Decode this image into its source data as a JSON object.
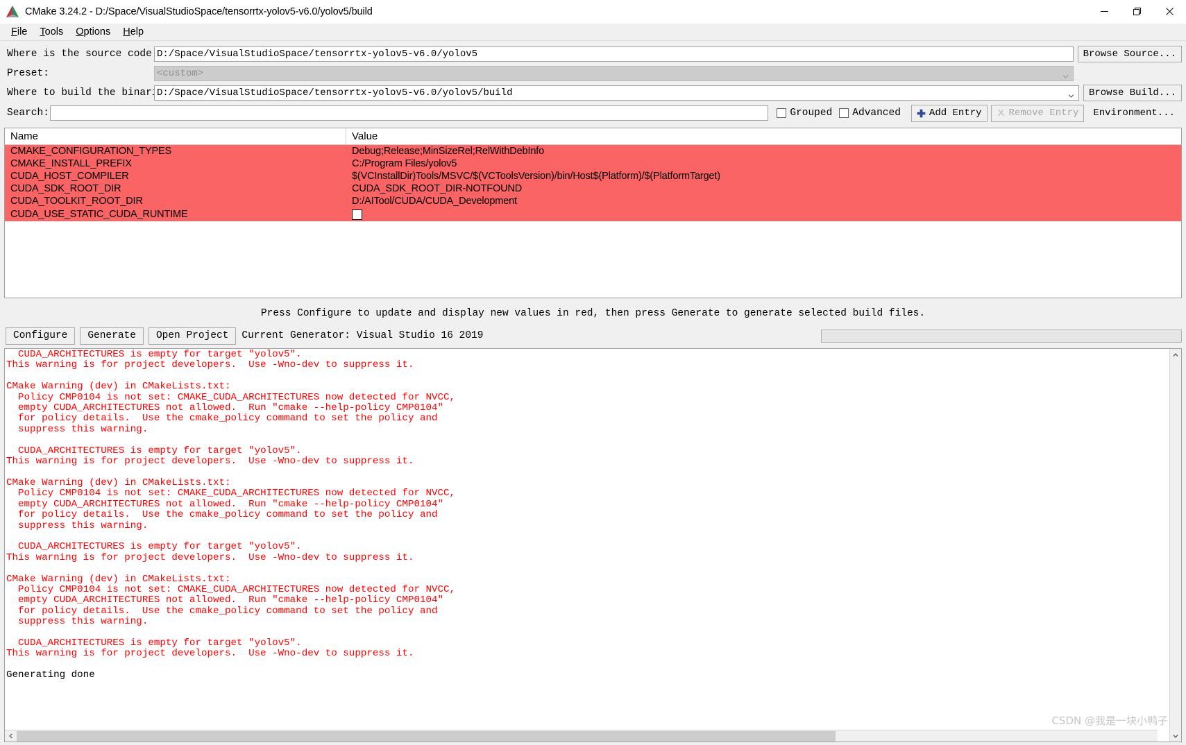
{
  "window": {
    "title": "CMake 3.24.2 - D:/Space/VisualStudioSpace/tensorrtx-yolov5-v6.0/yolov5/build",
    "app_icon": "cmake-logo-icon",
    "minimize_label": "—",
    "maximize_label": "❐",
    "close_label": "✕"
  },
  "menu": {
    "items": [
      {
        "label": "File",
        "mnemonic": "F"
      },
      {
        "label": "Tools",
        "mnemonic": "T"
      },
      {
        "label": "Options",
        "mnemonic": "O"
      },
      {
        "label": "Help",
        "mnemonic": "H"
      }
    ]
  },
  "form": {
    "source_label": "Where is the source code:",
    "source_value": "D:/Space/VisualStudioSpace/tensorrtx-yolov5-v6.0/yolov5",
    "browse_source_label": "Browse Source...",
    "preset_label": "Preset:",
    "preset_value": "<custom>",
    "build_label": "Where to build the binaries:",
    "build_value": "D:/Space/VisualStudioSpace/tensorrtx-yolov5-v6.0/yolov5/build",
    "browse_build_label": "Browse Build..."
  },
  "search": {
    "label": "Search:",
    "value": "",
    "placeholder": "",
    "grouped_label": "Grouped",
    "grouped_checked": false,
    "advanced_label": "Advanced",
    "advanced_checked": false,
    "add_entry_label": "Add Entry",
    "add_entry_icon": "plus-icon",
    "remove_entry_label": "Remove Entry",
    "remove_entry_icon": "remove-x-icon",
    "remove_entry_disabled": true,
    "environment_label": "Environment..."
  },
  "cache_table": {
    "columns": [
      "Name",
      "Value"
    ],
    "row_color": "#fa6464",
    "rows": [
      {
        "name": "CMAKE_CONFIGURATION_TYPES",
        "value": "Debug;Release;MinSizeRel;RelWithDebInfo",
        "type": "text"
      },
      {
        "name": "CMAKE_INSTALL_PREFIX",
        "value": "C:/Program Files/yolov5",
        "type": "text"
      },
      {
        "name": "CUDA_HOST_COMPILER",
        "value": "$(VCInstallDir)Tools/MSVC/$(VCToolsVersion)/bin/Host$(Platform)/$(PlatformTarget)",
        "type": "text"
      },
      {
        "name": "CUDA_SDK_ROOT_DIR",
        "value": "CUDA_SDK_ROOT_DIR-NOTFOUND",
        "type": "text"
      },
      {
        "name": "CUDA_TOOLKIT_ROOT_DIR",
        "value": "D:/AITool/CUDA/CUDA_Development",
        "type": "text"
      },
      {
        "name": "CUDA_USE_STATIC_CUDA_RUNTIME",
        "value": "",
        "type": "checkbox",
        "checked": false
      }
    ]
  },
  "hint": "Press Configure to update and display new values in red, then press Generate to generate selected build files.",
  "actions": {
    "configure_label": "Configure",
    "generate_label": "Generate",
    "open_project_label": "Open Project",
    "current_generator": "Current Generator: Visual Studio 16 2019",
    "progress_value": 0
  },
  "log": {
    "lines": [
      {
        "text": "  CUDA_ARCHITECTURES is empty for target \"yolov5\".",
        "color": "red"
      },
      {
        "text": "This warning is for project developers.  Use -Wno-dev to suppress it.",
        "color": "red"
      },
      {
        "text": "",
        "color": "red"
      },
      {
        "text": "CMake Warning (dev) in CMakeLists.txt:",
        "color": "red"
      },
      {
        "text": "  Policy CMP0104 is not set: CMAKE_CUDA_ARCHITECTURES now detected for NVCC,",
        "color": "red"
      },
      {
        "text": "  empty CUDA_ARCHITECTURES not allowed.  Run \"cmake --help-policy CMP0104\"",
        "color": "red"
      },
      {
        "text": "  for policy details.  Use the cmake_policy command to set the policy and",
        "color": "red"
      },
      {
        "text": "  suppress this warning.",
        "color": "red"
      },
      {
        "text": "",
        "color": "red"
      },
      {
        "text": "  CUDA_ARCHITECTURES is empty for target \"yolov5\".",
        "color": "red"
      },
      {
        "text": "This warning is for project developers.  Use -Wno-dev to suppress it.",
        "color": "red"
      },
      {
        "text": "",
        "color": "red"
      },
      {
        "text": "CMake Warning (dev) in CMakeLists.txt:",
        "color": "red"
      },
      {
        "text": "  Policy CMP0104 is not set: CMAKE_CUDA_ARCHITECTURES now detected for NVCC,",
        "color": "red"
      },
      {
        "text": "  empty CUDA_ARCHITECTURES not allowed.  Run \"cmake --help-policy CMP0104\"",
        "color": "red"
      },
      {
        "text": "  for policy details.  Use the cmake_policy command to set the policy and",
        "color": "red"
      },
      {
        "text": "  suppress this warning.",
        "color": "red"
      },
      {
        "text": "",
        "color": "red"
      },
      {
        "text": "  CUDA_ARCHITECTURES is empty for target \"yolov5\".",
        "color": "red"
      },
      {
        "text": "This warning is for project developers.  Use -Wno-dev to suppress it.",
        "color": "red"
      },
      {
        "text": "",
        "color": "red"
      },
      {
        "text": "CMake Warning (dev) in CMakeLists.txt:",
        "color": "red"
      },
      {
        "text": "  Policy CMP0104 is not set: CMAKE_CUDA_ARCHITECTURES now detected for NVCC,",
        "color": "red"
      },
      {
        "text": "  empty CUDA_ARCHITECTURES not allowed.  Run \"cmake --help-policy CMP0104\"",
        "color": "red"
      },
      {
        "text": "  for policy details.  Use the cmake_policy command to set the policy and",
        "color": "red"
      },
      {
        "text": "  suppress this warning.",
        "color": "red"
      },
      {
        "text": "",
        "color": "red"
      },
      {
        "text": "  CUDA_ARCHITECTURES is empty for target \"yolov5\".",
        "color": "red"
      },
      {
        "text": "This warning is for project developers.  Use -Wno-dev to suppress it.",
        "color": "red"
      },
      {
        "text": "",
        "color": "red"
      },
      {
        "text": "Generating done",
        "color": "black"
      }
    ],
    "scroll_up_icon": "chevron-up-icon",
    "scroll_down_icon": "chevron-down-icon",
    "scroll_left_icon": "chevron-left-icon"
  },
  "watermark": "CSDN @我是一块小鸭子"
}
